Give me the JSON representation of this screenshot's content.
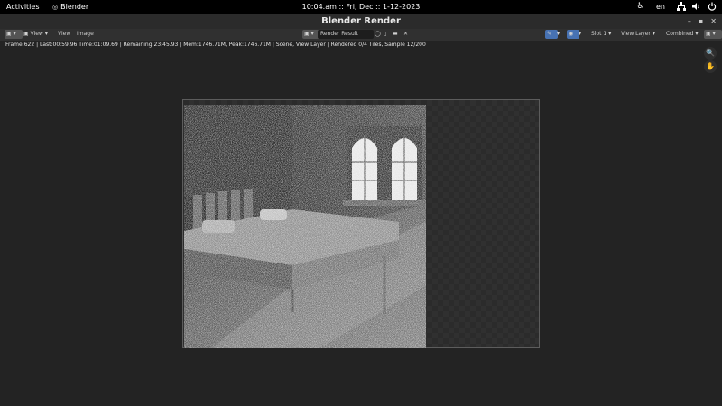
{
  "os_bar": {
    "activities": "Activities",
    "app_name": "Blender",
    "clock": "10:04.am :: Fri, Dec ::  1-12-2023",
    "lang": "en"
  },
  "window": {
    "title": "Blender Render"
  },
  "header": {
    "view_menu": "View",
    "view": "View",
    "image": "Image",
    "image_name": "Render Result",
    "slot": "Slot 1",
    "view_layer": "View Layer",
    "pass": "Combined"
  },
  "status": "Frame:622 | Last:00:59.96 Time:01:09.69 | Remaining:23:45.93 | Mem:1746.71M, Peak:1746.71M | Scene, View Layer | Rendered 0/4 Tiles, Sample 12/200"
}
